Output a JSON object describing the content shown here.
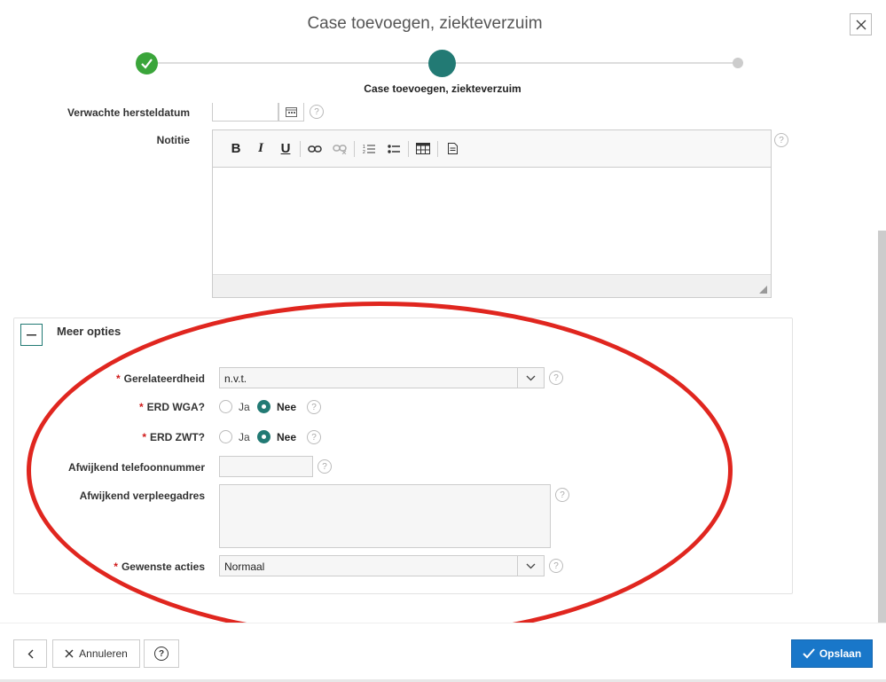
{
  "dialog": {
    "title": "Case toevoegen, ziekteverzuim",
    "close_icon": "close-icon"
  },
  "wizard": {
    "current_step_label": "Case toevoegen, ziekteverzuim",
    "colors": {
      "done": "#3aa53a",
      "current": "#227a74",
      "pending": "#cccccc"
    }
  },
  "form": {
    "hersteldatum_label": "Verwachte hersteldatum",
    "notitie_label": "Notitie",
    "editor_toolbar": [
      "bold-icon",
      "italic-icon",
      "underline-icon",
      "link-icon",
      "unlink-icon",
      "numbered-list-icon",
      "bulleted-list-icon",
      "table-icon",
      "document-icon"
    ]
  },
  "meer_opties": {
    "title": "Meer opties",
    "gerelateerdheid": {
      "label": "Gerelateerdheid",
      "value": "n.v.t."
    },
    "erd_wga": {
      "label": "ERD WGA?",
      "option_ja": "Ja",
      "option_nee": "Nee",
      "selected": "Nee"
    },
    "erd_zwt": {
      "label": "ERD ZWT?",
      "option_ja": "Ja",
      "option_nee": "Nee",
      "selected": "Nee"
    },
    "telefoon": {
      "label": "Afwijkend telefoonnummer",
      "value": ""
    },
    "verpleegadres": {
      "label": "Afwijkend verpleegadres",
      "value": ""
    },
    "gewenste_acties": {
      "label": "Gewenste acties",
      "value": "Normaal"
    }
  },
  "footer": {
    "back_icon": "chevron-left-icon",
    "cancel_label": "Annuleren",
    "help_icon": "help-icon",
    "save_label": "Opslaan",
    "accent": "#1977c9"
  },
  "annotation": {
    "color": "#e0261f"
  }
}
